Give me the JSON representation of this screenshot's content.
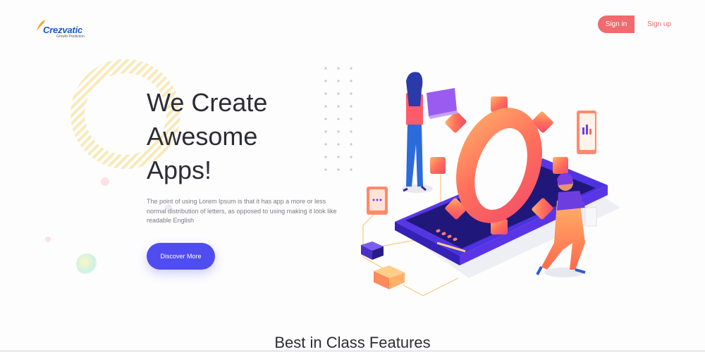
{
  "header": {
    "logo_text": "Crezvatic",
    "logo_tagline": "Growth Prediction",
    "signin_label": "Sign in",
    "signup_label": "Sign up"
  },
  "hero": {
    "title": "We Create Awesome Apps!",
    "description": "The point of using Lorem Ipsum is that it has app a more or less normal distribution of letters, as opposed to using making it look like readable English",
    "cta_label": "Discover More"
  },
  "features": {
    "title": "Best in Class Features"
  },
  "colors": {
    "accent_coral": "#f06a6e",
    "accent_blue": "#4f4cf0",
    "logo_blue": "#1a56c7"
  }
}
